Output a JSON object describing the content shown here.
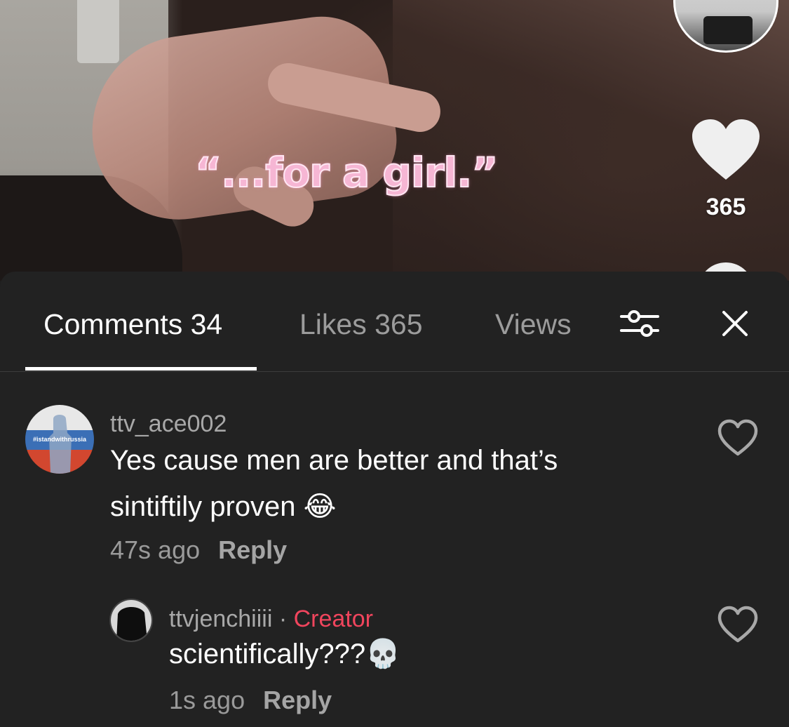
{
  "video": {
    "overlay_text": "“...for a girl.”",
    "like_count": "365"
  },
  "icons": {
    "heart": "heart-icon",
    "filter": "sliders-icon",
    "close": "close-icon"
  },
  "tabs": [
    {
      "label": "Comments 34",
      "active": true
    },
    {
      "label": "Likes 365",
      "active": false
    },
    {
      "label": "Views",
      "active": false
    }
  ],
  "comments": [
    {
      "username": "ttv_ace002",
      "avatar_text": "#istandwithrussia",
      "text": "Yes cause men are better and that’s sintiftily proven 😂",
      "time": "47s ago",
      "reply_label": "Reply"
    },
    {
      "username": "ttvjenchiiii",
      "separator": "·",
      "badge": "Creator",
      "text": "scientifically???💀",
      "time": "1s ago",
      "reply_label": "Reply"
    }
  ],
  "colors": {
    "sheet_bg": "#222222",
    "creator_badge": "#f0455d",
    "overlay_pink": "#f6b6d4"
  }
}
